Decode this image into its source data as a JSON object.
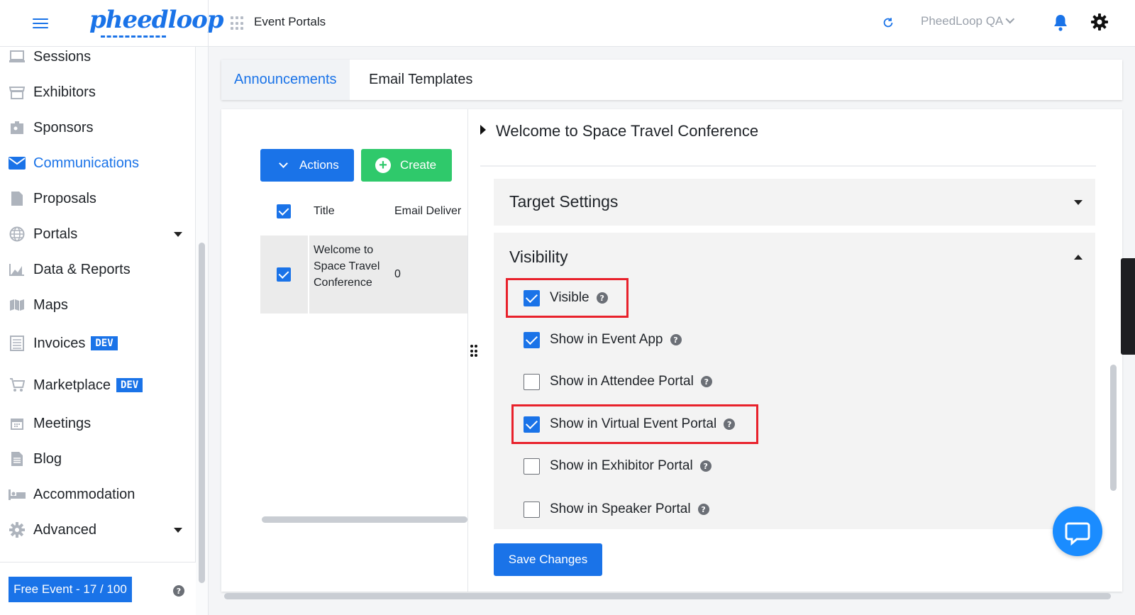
{
  "header": {
    "logo_text": "pheedloop",
    "title": "Event Portals",
    "org_selector": "PheedLoop QA"
  },
  "sidebar": {
    "items": [
      {
        "label": "Sessions"
      },
      {
        "label": "Exhibitors"
      },
      {
        "label": "Sponsors"
      },
      {
        "label": "Communications"
      },
      {
        "label": "Proposals"
      },
      {
        "label": "Portals"
      },
      {
        "label": "Data & Reports"
      },
      {
        "label": "Maps"
      },
      {
        "label": "Invoices",
        "badge": "DEV"
      },
      {
        "label": "Marketplace",
        "badge": "DEV"
      },
      {
        "label": "Meetings"
      },
      {
        "label": "Blog"
      },
      {
        "label": "Accommodation"
      },
      {
        "label": "Advanced"
      }
    ],
    "active": "Communications",
    "footer_label": "Free Event - 17 / 100"
  },
  "tabs": [
    {
      "label": "Announcements",
      "active": true
    },
    {
      "label": "Email Templates",
      "active": false
    }
  ],
  "list": {
    "actions_label": "Actions",
    "create_label": "Create",
    "columns": [
      "Title",
      "Email Deliver"
    ],
    "rows": [
      {
        "title": "Welcome to Space Travel Conference",
        "email_delivered": "0",
        "checked": true
      }
    ]
  },
  "detail": {
    "title": "Welcome to Space Travel Conference",
    "target_settings_label": "Target Settings",
    "visibility_label": "Visibility",
    "visibility_options": [
      {
        "label": "Visible",
        "checked": true
      },
      {
        "label": "Show in Event App",
        "checked": true
      },
      {
        "label": "Show in Attendee Portal",
        "checked": false
      },
      {
        "label": "Show in Virtual Event Portal",
        "checked": true
      },
      {
        "label": "Show in Exhibitor Portal",
        "checked": false
      },
      {
        "label": "Show in Speaker Portal",
        "checked": false
      }
    ],
    "save_label": "Save Changes"
  },
  "colors": {
    "accent": "#1a73e8",
    "create_green": "#2fc96b",
    "highlight_red": "#e8212b"
  }
}
